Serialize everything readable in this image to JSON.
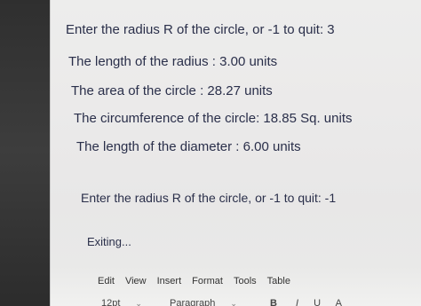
{
  "console": {
    "lines": [
      "Enter the radius R of the circle, or -1 to quit: 3",
      "The length of the radius : 3.00 units",
      "The area of the circle : 28.27 units",
      "The circumference of the circle: 18.85 Sq. units",
      "The length of the diameter : 6.00 units",
      "Enter the radius R of the circle, or -1 to quit: -1",
      "Exiting..."
    ]
  },
  "editor": {
    "menu": [
      "Edit",
      "View",
      "Insert",
      "Format",
      "Tools",
      "Table"
    ],
    "toolbar": {
      "font_size": "12pt",
      "block_format": "Paragraph",
      "bold": "B",
      "italic": "I",
      "underline": "U",
      "more": "A"
    }
  }
}
